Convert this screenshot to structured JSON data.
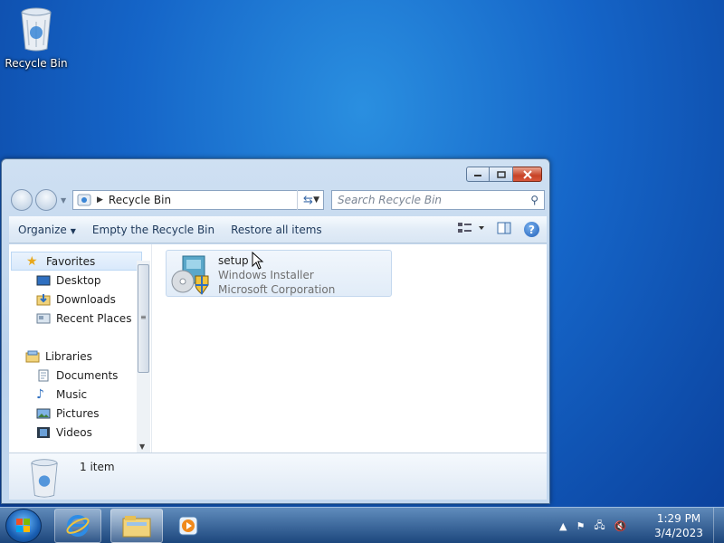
{
  "desktop": {
    "icons": [
      {
        "label": "Recycle Bin",
        "icon": "recycle-bin-icon"
      }
    ]
  },
  "window": {
    "address": {
      "location": "Recycle Bin"
    },
    "search": {
      "placeholder": "Search Recycle Bin"
    },
    "toolbar": {
      "organize_label": "Organize",
      "empty_label": "Empty the Recycle Bin",
      "restore_label": "Restore all items"
    },
    "nav": {
      "favorites": "Favorites",
      "desktop": "Desktop",
      "downloads": "Downloads",
      "recent": "Recent Places",
      "libraries": "Libraries",
      "documents": "Documents",
      "music": "Music",
      "pictures": "Pictures",
      "videos": "Videos"
    },
    "files": [
      {
        "name": "setup",
        "type": "Windows Installer",
        "company": "Microsoft Corporation",
        "icon": "installer-icon"
      }
    ],
    "details": {
      "count": "1 item"
    }
  },
  "taskbar": {
    "clock": {
      "time": "1:29 PM",
      "date": "3/4/2023"
    },
    "colors": {
      "accent": "#1565c8",
      "close": "#c74226"
    }
  }
}
